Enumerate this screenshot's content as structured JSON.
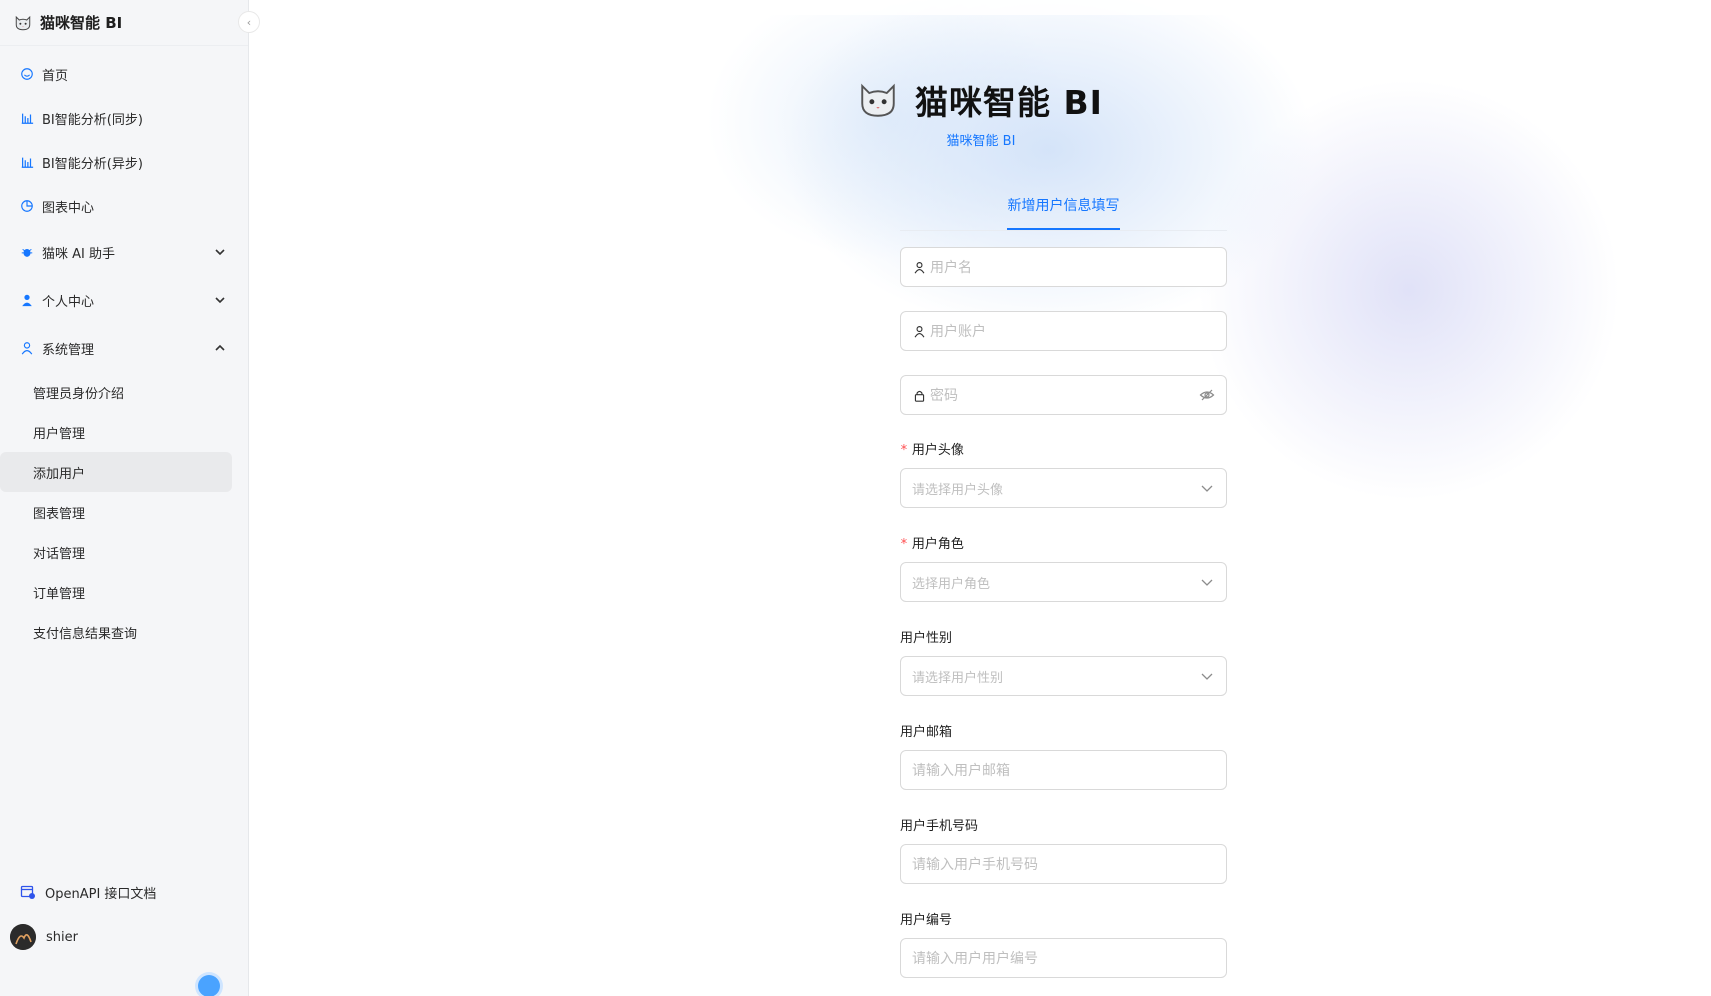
{
  "app": {
    "title": "猫咪智能 BI"
  },
  "sidebar": {
    "items": [
      {
        "label": "首页",
        "icon": "smile-icon"
      },
      {
        "label": "BI智能分析(同步)",
        "icon": "bar-chart-icon"
      },
      {
        "label": "BI智能分析(异步)",
        "icon": "bar-chart-icon"
      },
      {
        "label": "图表中心",
        "icon": "pie-chart-icon"
      },
      {
        "label": "猫咪 AI 助手",
        "icon": "bug-icon",
        "expandable": true,
        "expanded": false
      },
      {
        "label": "个人中心",
        "icon": "user-icon",
        "expandable": true,
        "expanded": false
      },
      {
        "label": "系统管理",
        "icon": "user-outline-icon",
        "expandable": true,
        "expanded": true
      }
    ],
    "submenu": [
      {
        "label": "管理员身份介绍",
        "active": false
      },
      {
        "label": "用户管理",
        "active": false
      },
      {
        "label": "添加用户",
        "active": true
      },
      {
        "label": "图表管理",
        "active": false
      },
      {
        "label": "对话管理",
        "active": false
      },
      {
        "label": "订单管理",
        "active": false
      },
      {
        "label": "支付信息结果查询",
        "active": false
      }
    ],
    "openapi_label": "OpenAPI 接口文档",
    "user_name": "shier"
  },
  "header": {
    "title": "猫咪智能 BI",
    "subtitle": "猫咪智能 BI"
  },
  "form": {
    "tab_label": "新增用户信息填写",
    "username_placeholder": "用户名",
    "account_placeholder": "用户账户",
    "password_placeholder": "密码",
    "avatar_label": "用户头像",
    "avatar_placeholder": "请选择用户头像",
    "role_label": "用户角色",
    "role_placeholder": "选择用户角色",
    "gender_label": "用户性别",
    "gender_placeholder": "请选择用户性别",
    "email_label": "用户邮箱",
    "email_placeholder": "请输入用户邮箱",
    "phone_label": "用户手机号码",
    "phone_placeholder": "请输入用户手机号码",
    "code_label": "用户编号",
    "code_placeholder": "请输入用户用户编号"
  },
  "colors": {
    "primary": "#1677ff",
    "required": "#ff4d4f"
  }
}
